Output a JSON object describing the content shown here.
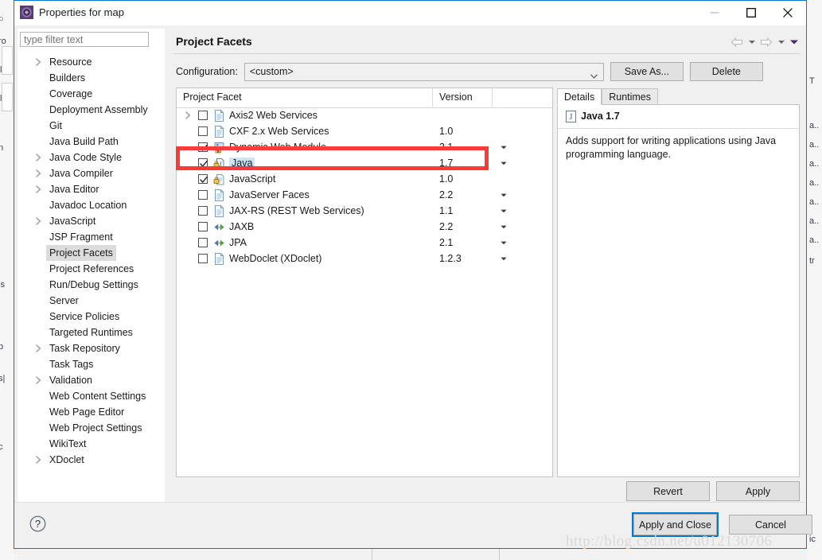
{
  "window": {
    "title": "Properties for map",
    "icon": "eclipse-properties-icon",
    "minimize_label": "Minimize",
    "maximize_label": "Maximize",
    "close_label": "Close"
  },
  "filter": {
    "placeholder": "type filter text",
    "value": ""
  },
  "sidebar": {
    "items": [
      {
        "label": "Resource",
        "expandable": true,
        "selected": false
      },
      {
        "label": "Builders",
        "expandable": false,
        "selected": false
      },
      {
        "label": "Coverage",
        "expandable": false,
        "selected": false
      },
      {
        "label": "Deployment Assembly",
        "expandable": false,
        "selected": false
      },
      {
        "label": "Git",
        "expandable": false,
        "selected": false
      },
      {
        "label": "Java Build Path",
        "expandable": false,
        "selected": false
      },
      {
        "label": "Java Code Style",
        "expandable": true,
        "selected": false
      },
      {
        "label": "Java Compiler",
        "expandable": true,
        "selected": false
      },
      {
        "label": "Java Editor",
        "expandable": true,
        "selected": false
      },
      {
        "label": "Javadoc Location",
        "expandable": false,
        "selected": false
      },
      {
        "label": "JavaScript",
        "expandable": true,
        "selected": false
      },
      {
        "label": "JSP Fragment",
        "expandable": false,
        "selected": false
      },
      {
        "label": "Project Facets",
        "expandable": false,
        "selected": true
      },
      {
        "label": "Project References",
        "expandable": false,
        "selected": false
      },
      {
        "label": "Run/Debug Settings",
        "expandable": false,
        "selected": false
      },
      {
        "label": "Server",
        "expandable": false,
        "selected": false
      },
      {
        "label": "Service Policies",
        "expandable": false,
        "selected": false
      },
      {
        "label": "Targeted Runtimes",
        "expandable": false,
        "selected": false
      },
      {
        "label": "Task Repository",
        "expandable": true,
        "selected": false
      },
      {
        "label": "Task Tags",
        "expandable": false,
        "selected": false
      },
      {
        "label": "Validation",
        "expandable": true,
        "selected": false
      },
      {
        "label": "Web Content Settings",
        "expandable": false,
        "selected": false
      },
      {
        "label": "Web Page Editor",
        "expandable": false,
        "selected": false
      },
      {
        "label": "Web Project Settings",
        "expandable": false,
        "selected": false
      },
      {
        "label": "WikiText",
        "expandable": false,
        "selected": false
      },
      {
        "label": "XDoclet",
        "expandable": true,
        "selected": false
      }
    ]
  },
  "page": {
    "title": "Project Facets",
    "nav": {
      "back_label": "Back",
      "back_menu_label": "Back history",
      "forward_label": "Forward",
      "forward_menu_label": "Forward history",
      "view_menu_label": "View menu"
    }
  },
  "configuration": {
    "label": "Configuration:",
    "value": "<custom>",
    "save_as_label": "Save As...",
    "delete_label": "Delete"
  },
  "facets": {
    "columns": [
      "Project Facet",
      "Version",
      ""
    ],
    "rows": [
      {
        "name": "Axis2 Web Services",
        "version": "",
        "checked": false,
        "expandable": true,
        "icon": "doc-icon",
        "dropdown": false,
        "selected": false
      },
      {
        "name": "CXF 2.x Web Services",
        "version": "1.0",
        "checked": false,
        "expandable": false,
        "icon": "doc-icon",
        "dropdown": false,
        "selected": false
      },
      {
        "name": "Dynamic Web Module",
        "version": "3.1",
        "checked": true,
        "expandable": false,
        "icon": "web-icon",
        "dropdown": true,
        "selected": false
      },
      {
        "name": "Java",
        "version": "1.7",
        "checked": true,
        "expandable": false,
        "icon": "java-icon",
        "dropdown": true,
        "selected": true
      },
      {
        "name": "JavaScript",
        "version": "1.0",
        "checked": true,
        "expandable": false,
        "icon": "js-icon",
        "dropdown": false,
        "selected": false
      },
      {
        "name": "JavaServer Faces",
        "version": "2.2",
        "checked": false,
        "expandable": false,
        "icon": "doc-icon",
        "dropdown": true,
        "selected": false
      },
      {
        "name": "JAX-RS (REST Web Services)",
        "version": "1.1",
        "checked": false,
        "expandable": false,
        "icon": "doc-icon",
        "dropdown": true,
        "selected": false
      },
      {
        "name": "JAXB",
        "version": "2.2",
        "checked": false,
        "expandable": false,
        "icon": "arrows-icon",
        "dropdown": true,
        "selected": false
      },
      {
        "name": "JPA",
        "version": "2.1",
        "checked": false,
        "expandable": false,
        "icon": "arrows-icon",
        "dropdown": true,
        "selected": false
      },
      {
        "name": "WebDoclet (XDoclet)",
        "version": "1.2.3",
        "checked": false,
        "expandable": false,
        "icon": "doc-icon",
        "dropdown": true,
        "selected": false
      }
    ]
  },
  "details": {
    "tabs": [
      {
        "label": "Details",
        "active": true
      },
      {
        "label": "Runtimes",
        "active": false
      }
    ],
    "header_icon": "java-icon",
    "header_title": "Java 1.7",
    "description": "Adds support for writing applications using Java programming language."
  },
  "actions": {
    "revert_label": "Revert",
    "apply_label": "Apply",
    "apply_and_close_label": "Apply and Close",
    "cancel_label": "Cancel",
    "help_label": "Help"
  },
  "annotation": {
    "highlight_color": "#fb3b39",
    "target_row": "Java"
  },
  "watermark": {
    "text": "http://blog.csdn.net/u012130706"
  },
  "colors": {
    "accent": "#0078d7",
    "selection": "#cde4f7",
    "dialog_bg": "#f0f0f0",
    "highlight": "#fb3b39"
  },
  "background": {
    "left_fragments": [
      "○",
      "ro",
      "‖",
      "‖",
      "n",
      "js",
      "p",
      "s|",
      "c"
    ],
    "right_fragments": [
      "T",
      "a..",
      "a..",
      "a..",
      "a..",
      "a..",
      "a..",
      "a..",
      "tr",
      "ic"
    ]
  }
}
